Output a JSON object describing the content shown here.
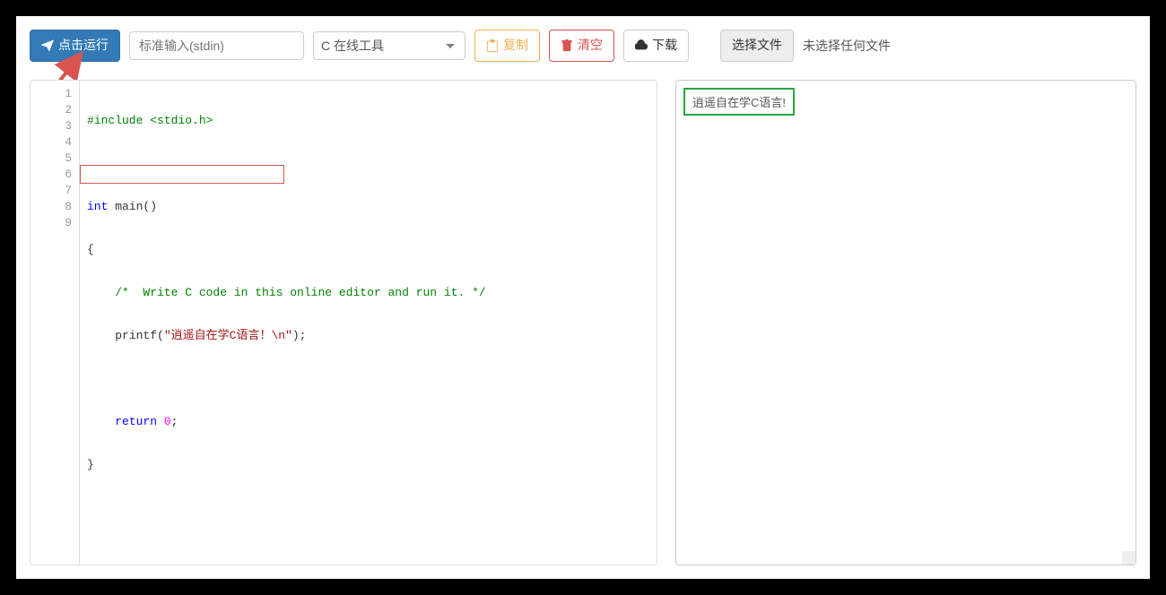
{
  "toolbar": {
    "run_label": "点击运行",
    "stdin_placeholder": "标准输入(stdin)",
    "tool_selected": "C 在线工具",
    "copy_label": "复制",
    "clear_label": "清空",
    "download_label": "下载",
    "choose_file_label": "选择文件",
    "no_file_text": "未选择任何文件"
  },
  "editor": {
    "line_numbers": [
      "1",
      "2",
      "3",
      "4",
      "5",
      "6",
      "7",
      "8",
      "9"
    ],
    "code_plain": "#include <stdio.h>\n\nint main()\n{\n    /*  Write C code in this online editor and run it. */\n    printf(\"逍遥自在学C语言！\\n\");\n\n    return 0;\n}",
    "tokens": {
      "l1_pp": "#include <stdio.h>",
      "l3_kw": "int",
      "l3_fn": " main()",
      "l4_brace": "{",
      "l5_indent": "    ",
      "l5_cm": "/*  Write C code in this online editor and run it. */",
      "l6_indent": "    ",
      "l6_fn": "printf",
      "l6_open": "(",
      "l6_str": "\"逍遥自在学C语言！\\n\"",
      "l6_close": ")",
      "l6_semi": ";",
      "l8_indent": "    ",
      "l8_kw": "return",
      "l8_sp": " ",
      "l8_num": "0",
      "l8_semi": ";",
      "l9_brace": "}"
    }
  },
  "output": {
    "text": "逍遥自在学C语言!"
  }
}
